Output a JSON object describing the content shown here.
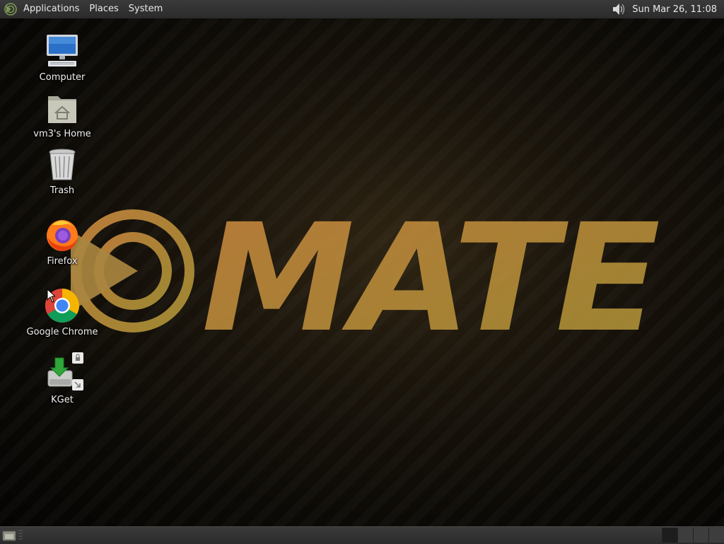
{
  "top_panel": {
    "menus": [
      "Applications",
      "Places",
      "System"
    ],
    "clock": "Sun Mar 26, 11:08",
    "icons": [
      "mate-menu-icon",
      "volume-icon"
    ]
  },
  "desktop": {
    "wallpaper_text": "MATE",
    "icons": [
      {
        "label": "Computer",
        "icon": "computer-icon"
      },
      {
        "label": "vm3's Home",
        "icon": "home-folder-icon"
      },
      {
        "label": "Trash",
        "icon": "trash-icon"
      },
      {
        "label": "Firefox",
        "icon": "firefox-icon"
      },
      {
        "label": "Google Chrome",
        "icon": "chrome-icon"
      },
      {
        "label": "KGet",
        "icon": "kget-icon"
      }
    ]
  },
  "bottom_panel": {
    "icons": [
      "show-desktop-icon"
    ],
    "workspaces": 4,
    "active_workspace": 1
  },
  "colors": {
    "panel": "#2f2f2f",
    "logo_orange": "#c98a3c",
    "logo_yellow": "#b8a038"
  }
}
